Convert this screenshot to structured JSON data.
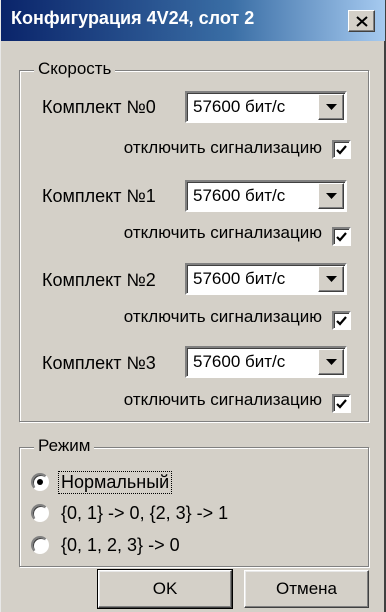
{
  "window": {
    "title": "Конфигурация 4V24, слот 2",
    "title_bar_colors": [
      "#0a246a",
      "#a6caf0"
    ]
  },
  "speed_group": {
    "legend": "Скорость",
    "kits": [
      {
        "label": "Комплект №0",
        "speed": "57600 бит/с",
        "disable_alarm_label": "отключить сигнализацию",
        "disable_alarm_checked": true
      },
      {
        "label": "Комплект №1",
        "speed": "57600 бит/с",
        "disable_alarm_label": "отключить сигнализацию",
        "disable_alarm_checked": true
      },
      {
        "label": "Комплект №2",
        "speed": "57600 бит/с",
        "disable_alarm_label": "отключить сигнализацию",
        "disable_alarm_checked": true
      },
      {
        "label": "Комплект №3",
        "speed": "57600 бит/с",
        "disable_alarm_label": "отключить сигнализацию",
        "disable_alarm_checked": true
      }
    ]
  },
  "mode_group": {
    "legend": "Режим",
    "options": [
      {
        "label": "Нормальный",
        "selected": true
      },
      {
        "label": "{0, 1} -> 0, {2, 3} -> 1",
        "selected": false
      },
      {
        "label": "{0, 1, 2, 3} -> 0",
        "selected": false
      }
    ]
  },
  "buttons": {
    "ok_label": "OK",
    "cancel_label": "Отмена"
  },
  "icons": {
    "close": "close-icon",
    "dropdown": "chevron-down-icon",
    "check": "checkmark-icon"
  }
}
